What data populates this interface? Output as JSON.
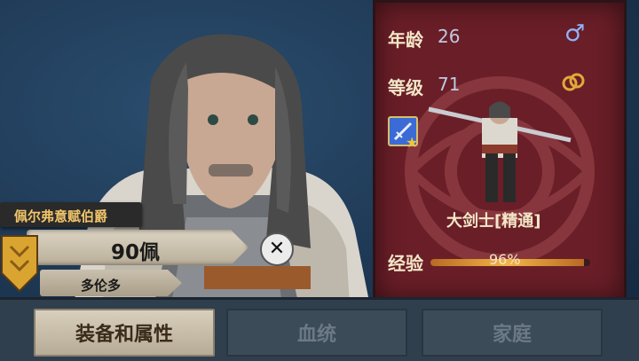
{
  "character": {
    "title": "佩尔弗意赋伯爵",
    "price": "90佩",
    "location": "多伦多"
  },
  "stats": {
    "age_label": "年龄",
    "age_value": "26",
    "level_label": "等级",
    "level_value": "71",
    "gender_icon": "male-icon",
    "status_icon": "rings-icon"
  },
  "unit": {
    "class_label": "大剑士[精通]",
    "skill_icon": "sword-skill-icon"
  },
  "experience": {
    "label": "经验",
    "percent_text": "96%",
    "progress": 0.96
  },
  "tabs": [
    {
      "label": "装备和属性",
      "active": true
    },
    {
      "label": "血统",
      "active": false
    },
    {
      "label": "家庭",
      "active": false
    }
  ],
  "colors": {
    "panel": "#6a1e27",
    "background": "#1f3a55",
    "accent_gold": "#f1c56a"
  }
}
